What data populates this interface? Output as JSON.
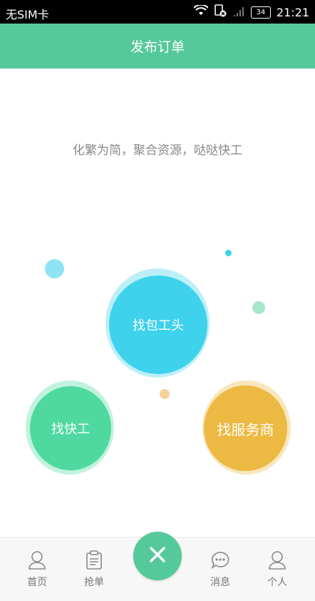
{
  "status_bar": {
    "carrier": "无SIM卡",
    "battery": "34",
    "time": "21:21"
  },
  "header": {
    "title": "发布订单"
  },
  "tagline": "化繁为简，聚合资源，哒哒快工",
  "bubbles": {
    "contractor": "找包工头",
    "quick_worker": "找快工",
    "service_provider": "找服务商"
  },
  "colors": {
    "brand": "#55c99a",
    "contractor": "#3ed2ec",
    "quick_worker": "#4fd9a0",
    "service_provider": "#ecb943"
  },
  "bottom_nav": {
    "items": [
      {
        "label": "首页",
        "icon": "person-icon"
      },
      {
        "label": "抢单",
        "icon": "clipboard-icon"
      },
      {
        "label": "",
        "icon": "close-icon"
      },
      {
        "label": "消息",
        "icon": "chat-icon"
      },
      {
        "label": "个人",
        "icon": "person-icon"
      }
    ]
  }
}
